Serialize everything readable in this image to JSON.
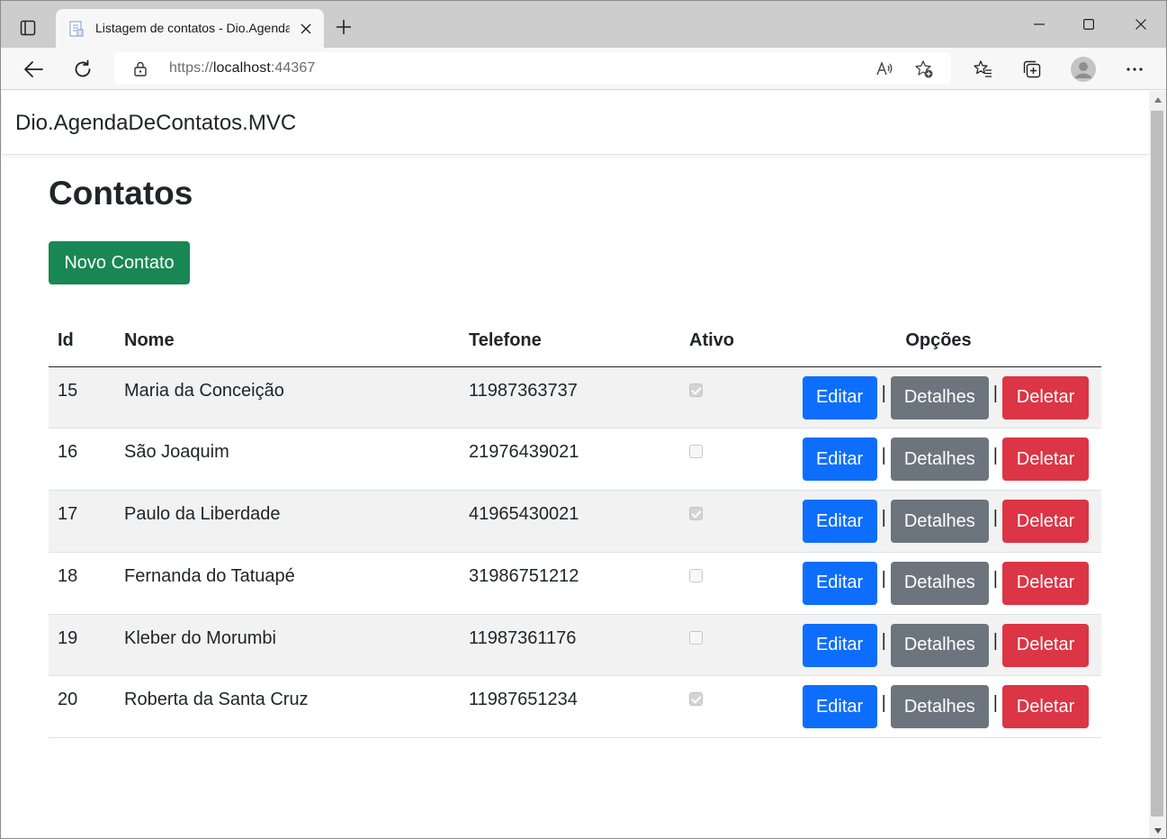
{
  "browser": {
    "tab_title": "Listagem de contatos - Dio.Agenda",
    "url_scheme": "https://",
    "url_host": "localhost",
    "url_port": ":44367"
  },
  "navbar": {
    "brand": "Dio.AgendaDeContatos.MVC"
  },
  "main": {
    "title": "Contatos",
    "new_button": "Novo Contato",
    "table": {
      "headers": {
        "id": "Id",
        "nome": "Nome",
        "telefone": "Telefone",
        "ativo": "Ativo",
        "opcoes": "Opções"
      },
      "separator": "|",
      "actions": {
        "edit": "Editar",
        "details": "Detalhes",
        "delete": "Deletar"
      },
      "rows": [
        {
          "id": "15",
          "nome": "Maria da Conceição",
          "telefone": "11987363737",
          "ativo": true
        },
        {
          "id": "16",
          "nome": "São Joaquim",
          "telefone": "21976439021",
          "ativo": false
        },
        {
          "id": "17",
          "nome": "Paulo da Liberdade",
          "telefone": "41965430021",
          "ativo": true
        },
        {
          "id": "18",
          "nome": "Fernanda do Tatuapé",
          "telefone": "31986751212",
          "ativo": false
        },
        {
          "id": "19",
          "nome": "Kleber do Morumbi",
          "telefone": "11987361176",
          "ativo": false
        },
        {
          "id": "20",
          "nome": "Roberta da Santa Cruz",
          "telefone": "11987651234",
          "ativo": true
        }
      ]
    }
  },
  "colors": {
    "success": "#198754",
    "primary": "#0d6efd",
    "secondary": "#6c757d",
    "danger": "#dc3545"
  }
}
